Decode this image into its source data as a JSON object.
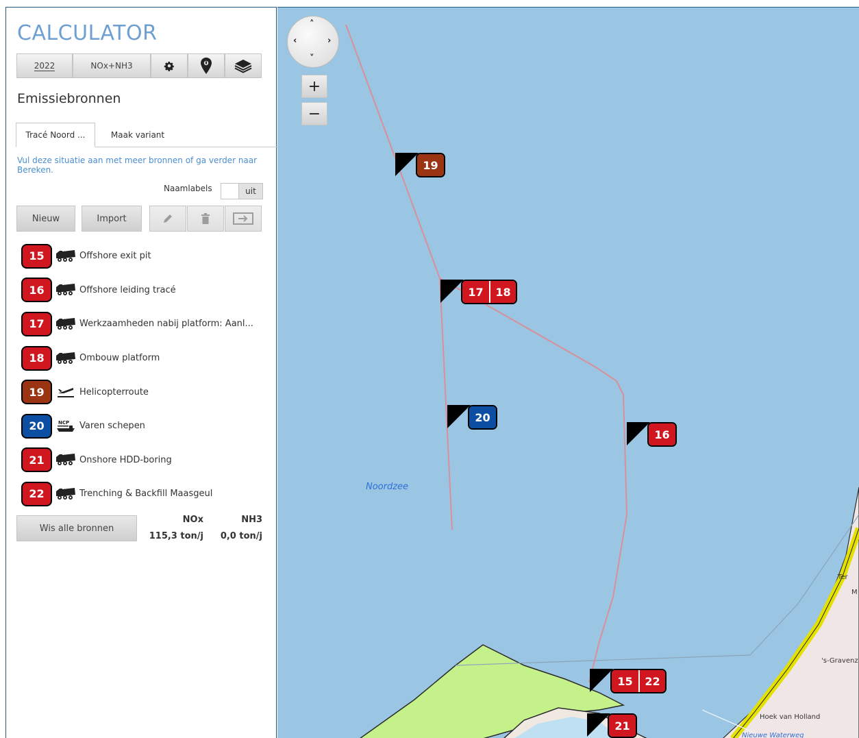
{
  "app": {
    "title": "CALCULATOR"
  },
  "toolbar": {
    "year": "2022",
    "substance": "NOx+NH3",
    "settings_icon": "gear-icon",
    "location_icon": "map-pin-icon",
    "layers_icon": "layers-icon"
  },
  "section": {
    "heading": "Emissiebronnen"
  },
  "tabs": [
    {
      "label": "Tracé Noord ..."
    },
    {
      "label": "Maak variant"
    }
  ],
  "info_text": "Vul deze situatie aan met meer bronnen of ga verder naar Bereken.",
  "labels_toggle": {
    "label": "Naamlabels",
    "value": "uit"
  },
  "actions": {
    "new_label": "Nieuw",
    "import_label": "Import",
    "edit_icon": "pencil-icon",
    "delete_icon": "trash-icon",
    "export_icon": "export-icon"
  },
  "colors": {
    "red": "#d0171f",
    "brown": "#9a3412",
    "blue": "#0b4ea2",
    "map_water": "#9ac6e4",
    "land_green": "#c5f18b",
    "title_blue": "#6e9fd1",
    "route_pink": "#d98f9a"
  },
  "sources": [
    {
      "id": "15",
      "color": "#d0171f",
      "icon": "truck-icon",
      "label": "Offshore exit pit"
    },
    {
      "id": "16",
      "color": "#d0171f",
      "icon": "truck-icon",
      "label": "Offshore leiding tracé"
    },
    {
      "id": "17",
      "color": "#d0171f",
      "icon": "truck-icon",
      "label": "Werkzaamheden nabij platform: Aanl..."
    },
    {
      "id": "18",
      "color": "#d0171f",
      "icon": "truck-icon",
      "label": "Ombouw platform"
    },
    {
      "id": "19",
      "color": "#9a3412",
      "icon": "plane-icon",
      "label": "Helicopterroute"
    },
    {
      "id": "20",
      "color": "#0b4ea2",
      "icon": "ship-icon",
      "label": "Varen schepen"
    },
    {
      "id": "21",
      "color": "#d0171f",
      "icon": "truck-icon",
      "label": "Onshore HDD-boring"
    },
    {
      "id": "22",
      "color": "#d0171f",
      "icon": "truck-icon",
      "label": "Trenching & Backfill Maasgeul"
    }
  ],
  "totals": {
    "clear_label": "Wis alle bronnen",
    "nox_label": "NOx",
    "nh3_label": "NH3",
    "nox_value": "115,3 ton/j",
    "nh3_value": "0,0 ton/j"
  },
  "map": {
    "markers": [
      {
        "ids": [
          "19"
        ],
        "color": "#9a3412"
      },
      {
        "ids": [
          "17",
          "18"
        ],
        "color": "#d0171f"
      },
      {
        "ids": [
          "20"
        ],
        "color": "#0b4ea2"
      },
      {
        "ids": [
          "16"
        ],
        "color": "#d0171f"
      },
      {
        "ids": [
          "15",
          "22"
        ],
        "color": "#d0171f"
      },
      {
        "ids": [
          "21"
        ],
        "color": "#d0171f"
      }
    ],
    "place_labels": {
      "sea": "Noordzee",
      "city_partial": "'s-Gravenz",
      "hoek": "Hoek van Holland",
      "waterweg": "Nieuwe Waterweg",
      "ter": "Ter",
      "m": "M"
    },
    "zoom_in": "+",
    "zoom_out": "−",
    "pan_icon": "pan-control-icon"
  }
}
